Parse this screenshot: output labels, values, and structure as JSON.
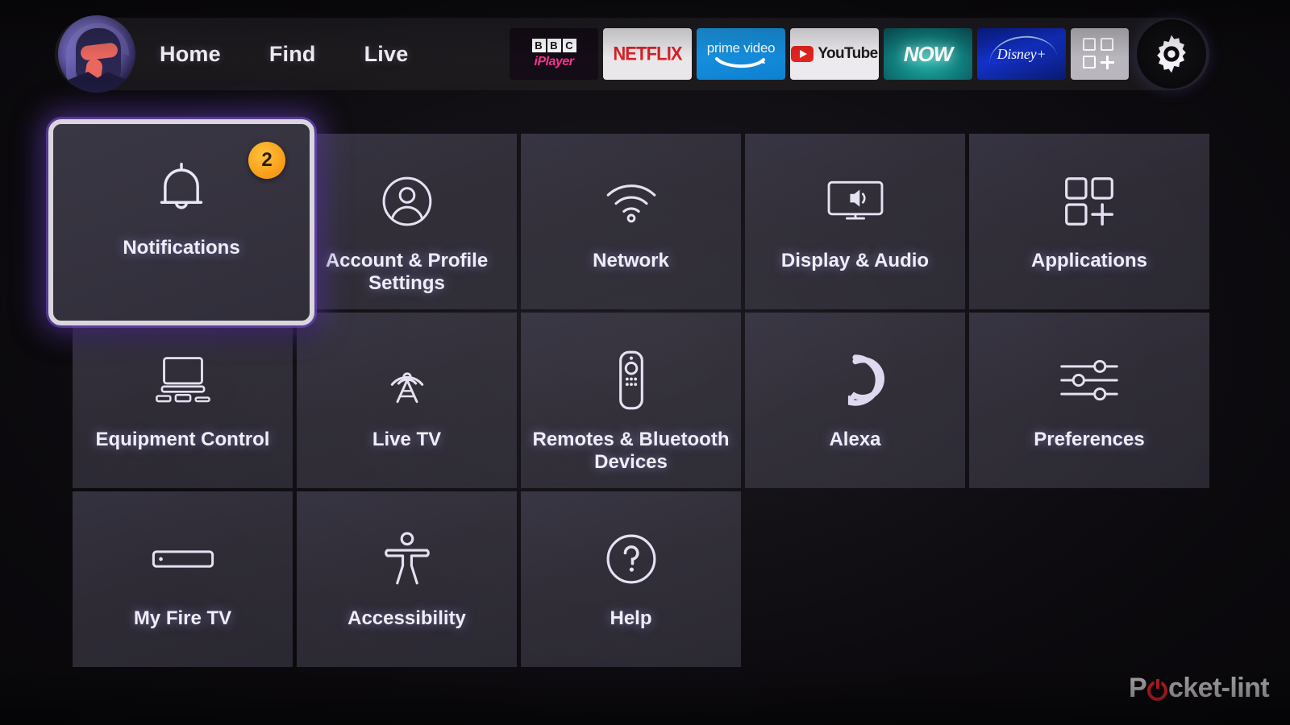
{
  "nav": {
    "avatar_name": "user-avatar",
    "links": [
      {
        "label": "Home"
      },
      {
        "label": "Find"
      },
      {
        "label": "Live"
      }
    ],
    "apps": [
      {
        "name": "bbc-iplayer",
        "b1": "B",
        "b2": "B",
        "b3": "C",
        "wordmark": "iPlayer"
      },
      {
        "name": "netflix",
        "wordmark": "NETFLIX"
      },
      {
        "name": "prime-video",
        "wordmark": "prime video"
      },
      {
        "name": "youtube",
        "wordmark": "YouTube"
      },
      {
        "name": "now",
        "wordmark": "NOW"
      },
      {
        "name": "disney-plus",
        "wordmark": "Disney+"
      },
      {
        "name": "apps-grid",
        "wordmark": ""
      }
    ],
    "settings_button_label": "Settings"
  },
  "settings_grid": {
    "selected": "Notifications",
    "tiles": [
      {
        "label": "Notifications",
        "icon": "bell-icon",
        "badge": "2",
        "selected": true
      },
      {
        "label": "Account & Profile Settings",
        "icon": "user-circle-icon"
      },
      {
        "label": "Network",
        "icon": "wifi-icon"
      },
      {
        "label": "Display & Audio",
        "icon": "tv-speaker-icon"
      },
      {
        "label": "Applications",
        "icon": "apps-grid-icon"
      },
      {
        "label": "Equipment Control",
        "icon": "monitor-devices-icon"
      },
      {
        "label": "Live TV",
        "icon": "broadcast-tower-icon"
      },
      {
        "label": "Remotes & Bluetooth Devices",
        "icon": "remote-control-icon"
      },
      {
        "label": "Alexa",
        "icon": "alexa-ring-icon"
      },
      {
        "label": "Preferences",
        "icon": "sliders-icon"
      },
      {
        "label": "My Fire TV",
        "icon": "fire-tv-stick-icon"
      },
      {
        "label": "Accessibility",
        "icon": "accessibility-person-icon"
      },
      {
        "label": "Help",
        "icon": "question-circle-icon"
      }
    ]
  },
  "watermark": {
    "pre": "P",
    "post": "cket-lint"
  },
  "colors": {
    "badge_orange": "#f9a01b",
    "tile_bg": "#2e2b35",
    "selection_border": "#d9d6de",
    "selection_glow": "#7046c8",
    "netflix_red": "#d81f26",
    "prime_blue": "#0c7fd0",
    "iplayer_pink": "#ff2e8e",
    "now_teal": "#0f7d7c",
    "disney_blue": "#1230c8",
    "youtube_red": "#e2211c",
    "watermark_red": "#cf2127"
  }
}
